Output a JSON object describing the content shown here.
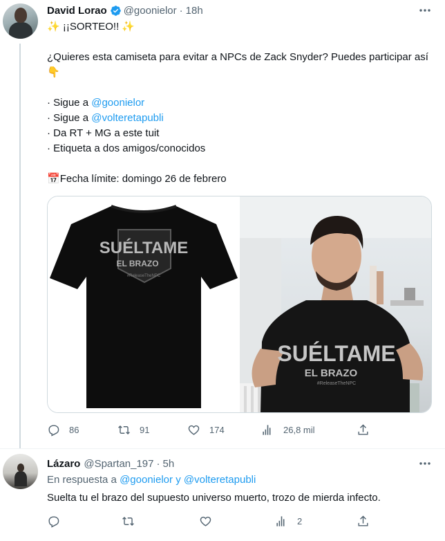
{
  "tweet1": {
    "author_name": "David Lorao",
    "author_handle": "@goonielor",
    "separator": "·",
    "time": "18h",
    "line1": "✨ ¡¡SORTEO!! ✨",
    "para1": "¿Quieres esta camiseta para evitar a NPCs de Zack Snyder? Puedes participar así 👇",
    "req1_prefix": "· Sigue a ",
    "req1_link": "@goonielor",
    "req2_prefix": "· Sigue a ",
    "req2_link": "@volteretapubli",
    "req3": "· Da RT + MG a este tuit",
    "req4": "· Etiqueta a dos amigos/conocidos",
    "deadline_icon": "📅",
    "deadline": "Fecha límite: domingo 26 de febrero",
    "shirt_text_main": "SUÉLTAME",
    "shirt_text_sub": "EL BRAZO",
    "shirt_tag": "#ReleaseTheNPC",
    "replies": "86",
    "retweets": "91",
    "likes": "174",
    "views": "26,8 mil"
  },
  "tweet2": {
    "author_name": "Lázaro",
    "author_handle": "@Spartan_197",
    "separator": "·",
    "time": "5h",
    "reply_prefix": "En respuesta a ",
    "reply_link1": "@goonielor",
    "reply_joiner": " y ",
    "reply_link2": "@volteretapubli",
    "text": "Suelta tu el brazo del supuesto universo muerto, trozo de mierda infecto.",
    "views": "2"
  },
  "colors": {
    "accent": "#1d9bf0",
    "secondary_text": "#536471",
    "primary_text": "#0f1419"
  }
}
